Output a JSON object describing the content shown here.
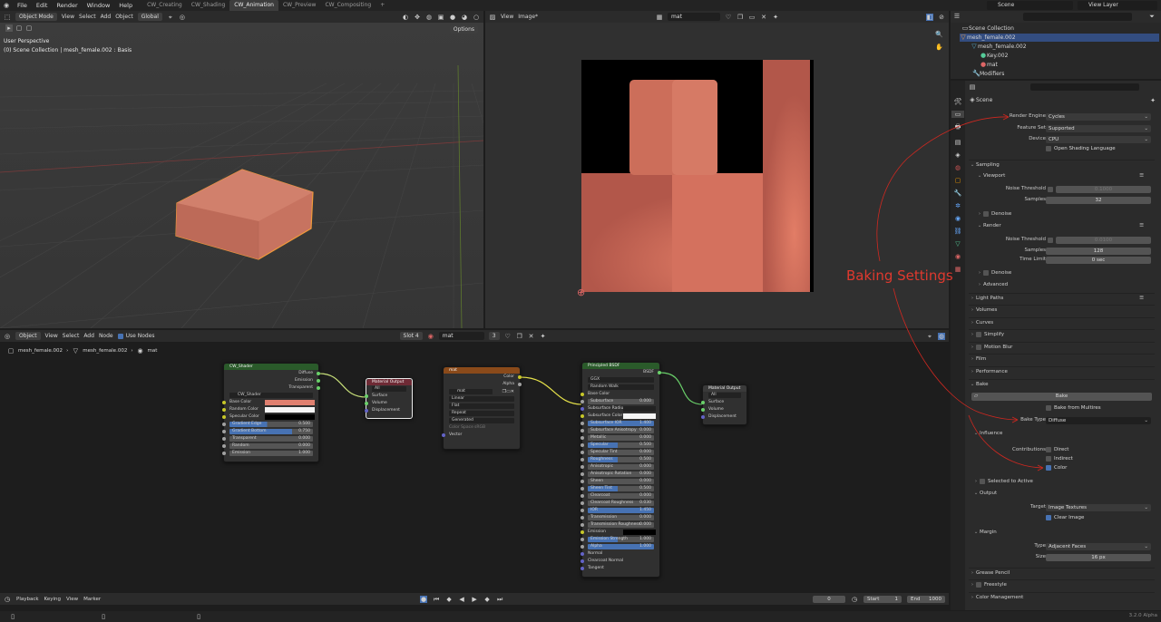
{
  "topbar": {
    "menus": [
      "File",
      "Edit",
      "Render",
      "Window",
      "Help"
    ],
    "workspaces": [
      "CW_Creating",
      "CW_Shading",
      "CW_Animation",
      "CW_Preview",
      "CW_Compositing"
    ],
    "active_workspace": "CW_Animation",
    "add": "+",
    "scene": "Scene",
    "view_layer": "View Layer"
  },
  "viewport": {
    "mode": "Object Mode",
    "menus": [
      "View",
      "Select",
      "Add",
      "Object"
    ],
    "orientation": "Global",
    "options": "Options",
    "overlay_line1": "User Perspective",
    "overlay_line2": "(0) Scene Collection | mesh_female.002 : Basis"
  },
  "image_editor": {
    "menus": [
      "View",
      "Image*"
    ],
    "image_name": "mat"
  },
  "annotation": {
    "text": "Baking Settings",
    "color": "#e0392e"
  },
  "node_editor": {
    "mode": "Object",
    "menus": [
      "View",
      "Select",
      "Add",
      "Node"
    ],
    "use_nodes": "Use Nodes",
    "slot": "Slot 4",
    "material": "mat",
    "users": "3",
    "breadcrumb": [
      "mesh_female.002",
      "mesh_female.002",
      "mat"
    ]
  },
  "nodes": {
    "cw_shader": {
      "title": "CW_Shader",
      "outputs": [
        "Diffuse",
        "Emission",
        "Transparent"
      ],
      "group": "CW_Shader",
      "rows": [
        {
          "label": "Base Color"
        },
        {
          "label": "Random Color"
        },
        {
          "label": "Specular Color"
        },
        {
          "label": "Gradient Edge",
          "value": "0.500"
        },
        {
          "label": "Gradient Bottom",
          "value": "0.750"
        },
        {
          "label": "Transparent",
          "value": "0.000"
        },
        {
          "label": "Random",
          "value": "0.000"
        },
        {
          "label": "Emission",
          "value": "1.000"
        }
      ]
    },
    "mat_output1": {
      "title": "Material Output",
      "target": "All",
      "inputs": [
        "Surface",
        "Volume",
        "Displacement"
      ]
    },
    "mat_tex": {
      "title": "mat",
      "outputs": [
        "Color",
        "Alpha"
      ],
      "image": "mat",
      "dropdowns": [
        "Linear",
        "Flat",
        "Repeat",
        "Generated"
      ],
      "color_space_label": "Color Space",
      "color_space": "sRGB",
      "input": "Vector"
    },
    "principled": {
      "title": "Principled BSDF",
      "output": "BSDF",
      "distribution": "GGX",
      "subsurface_method": "Random Walk",
      "rows": [
        {
          "label": "Base Color"
        },
        {
          "label": "Subsurface",
          "value": "0.000"
        },
        {
          "label": "Subsurface Radius"
        },
        {
          "label": "Subsurface Color"
        },
        {
          "label": "Subsurface IOR",
          "value": "1.400"
        },
        {
          "label": "Subsurface Anisotropy",
          "value": "0.000"
        },
        {
          "label": "Metallic",
          "value": "0.000"
        },
        {
          "label": "Specular",
          "value": "0.500"
        },
        {
          "label": "Specular Tint",
          "value": "0.000"
        },
        {
          "label": "Roughness",
          "value": "0.500"
        },
        {
          "label": "Anisotropic",
          "value": "0.000"
        },
        {
          "label": "Anisotropic Rotation",
          "value": "0.000"
        },
        {
          "label": "Sheen",
          "value": "0.000"
        },
        {
          "label": "Sheen Tint",
          "value": "0.500"
        },
        {
          "label": "Clearcoat",
          "value": "0.000"
        },
        {
          "label": "Clearcoat Roughness",
          "value": "0.030"
        },
        {
          "label": "IOR",
          "value": "1.450"
        },
        {
          "label": "Transmission",
          "value": "0.000"
        },
        {
          "label": "Transmission Roughness",
          "value": "0.000"
        },
        {
          "label": "Emission"
        },
        {
          "label": "Emission Strength",
          "value": "1.000"
        },
        {
          "label": "Alpha",
          "value": "1.000"
        },
        {
          "label": "Normal"
        },
        {
          "label": "Clearcoat Normal"
        },
        {
          "label": "Tangent"
        }
      ]
    },
    "mat_output2": {
      "title": "Material Output",
      "target": "All",
      "inputs": [
        "Surface",
        "Volume",
        "Displacement"
      ]
    }
  },
  "outliner": {
    "items": [
      "Scene Collection",
      "mesh_female.002",
      "mesh_female.002",
      "Key.002",
      "mat",
      "Modifiers"
    ]
  },
  "properties": {
    "header": "Scene",
    "render_engine_label": "Render Engine",
    "render_engine": "Cycles",
    "feature_set_label": "Feature Set",
    "feature_set": "Supported",
    "device_label": "Device",
    "device": "CPU",
    "osl": "Open Shading Language",
    "sampling": "Sampling",
    "viewport": "Viewport",
    "noise_threshold": "Noise Threshold",
    "vp_noise_value": "0.1000",
    "samples": "Samples",
    "vp_samples": "32",
    "denoise": "Denoise",
    "render": "Render",
    "r_noise_value": "0.0100",
    "r_samples": "128",
    "time_limit": "Time Limit",
    "time_limit_value": "0 sec",
    "advanced": "Advanced",
    "sections": [
      "Light Paths",
      "Volumes",
      "Curves",
      "Simplify",
      "Motion Blur",
      "Film",
      "Performance"
    ],
    "bake": "Bake",
    "bake_button": "Bake",
    "bake_multires": "Bake from Multires",
    "bake_type_label": "Bake Type",
    "bake_type": "Diffuse",
    "influence": "Influence",
    "contributions": "Contributions",
    "direct": "Direct",
    "indirect": "Indirect",
    "color": "Color",
    "selected_to_active": "Selected to Active",
    "output": "Output",
    "target_label": "Target",
    "target": "Image Textures",
    "clear_image": "Clear Image",
    "margin": "Margin",
    "type_label": "Type",
    "margin_type": "Adjacent Faces",
    "size_label": "Size",
    "size": "16 px",
    "grease_pencil": "Grease Pencil",
    "freestyle": "Freestyle",
    "color_management": "Color Management"
  },
  "timeline": {
    "menus": [
      "Playback",
      "Keying",
      "View",
      "Marker"
    ],
    "current": "0",
    "start_label": "Start",
    "start": "1",
    "end_label": "End",
    "end": "1000"
  },
  "status": {
    "version": "3.2.0 Alpha"
  }
}
